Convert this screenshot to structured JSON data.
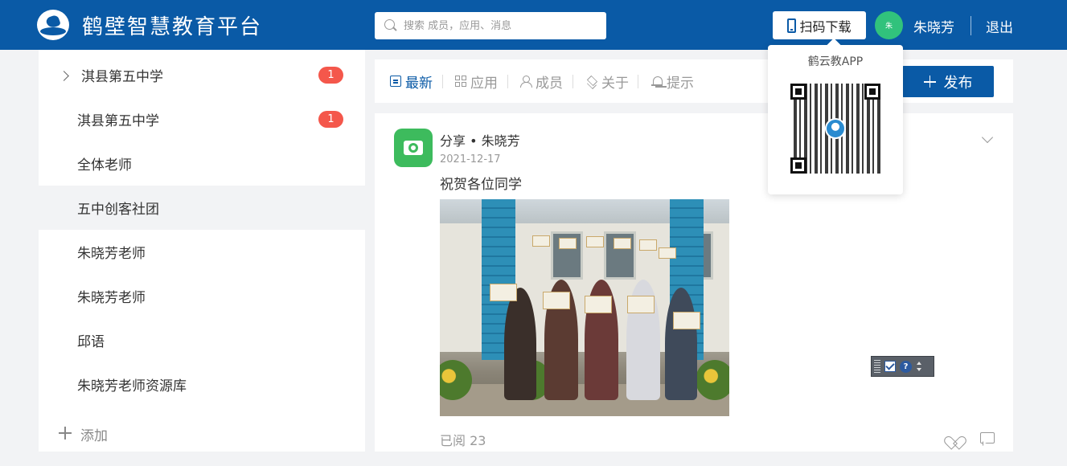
{
  "header": {
    "title": "鹤壁智慧教育平台",
    "search_placeholder": "搜索 成员，应用、消息",
    "scan_download": "扫码下载",
    "avatar_text": "朱",
    "user_name": "朱晓芳",
    "logout": "退出",
    "brand_color": "#0a5aa6"
  },
  "sidebar": {
    "items": [
      {
        "label": "淇县第五中学",
        "badge": "1",
        "expandable": true
      },
      {
        "label": "淇县第五中学",
        "badge": "1"
      },
      {
        "label": "全体老师"
      },
      {
        "label": "五中创客社团",
        "active": true
      },
      {
        "label": "朱晓芳老师"
      },
      {
        "label": "朱晓芳老师"
      },
      {
        "label": "邱语"
      },
      {
        "label": "朱晓芳老师资源库"
      }
    ],
    "add_label": "添加"
  },
  "tabs": {
    "items": [
      {
        "label": "最新",
        "icon": "document-icon",
        "active": true
      },
      {
        "label": "应用",
        "icon": "grid-icon"
      },
      {
        "label": "成员",
        "icon": "user-icon"
      },
      {
        "label": "关于",
        "icon": "layers-icon"
      },
      {
        "label": "提示",
        "icon": "bell-icon"
      }
    ],
    "publish": "发布"
  },
  "post": {
    "header": "分享 • 朱晓芳",
    "date": "2021-12-17",
    "text": "祝贺各位同学",
    "read_count": "已阅 23"
  },
  "qr_popup": {
    "title": "鹤云教APP"
  }
}
